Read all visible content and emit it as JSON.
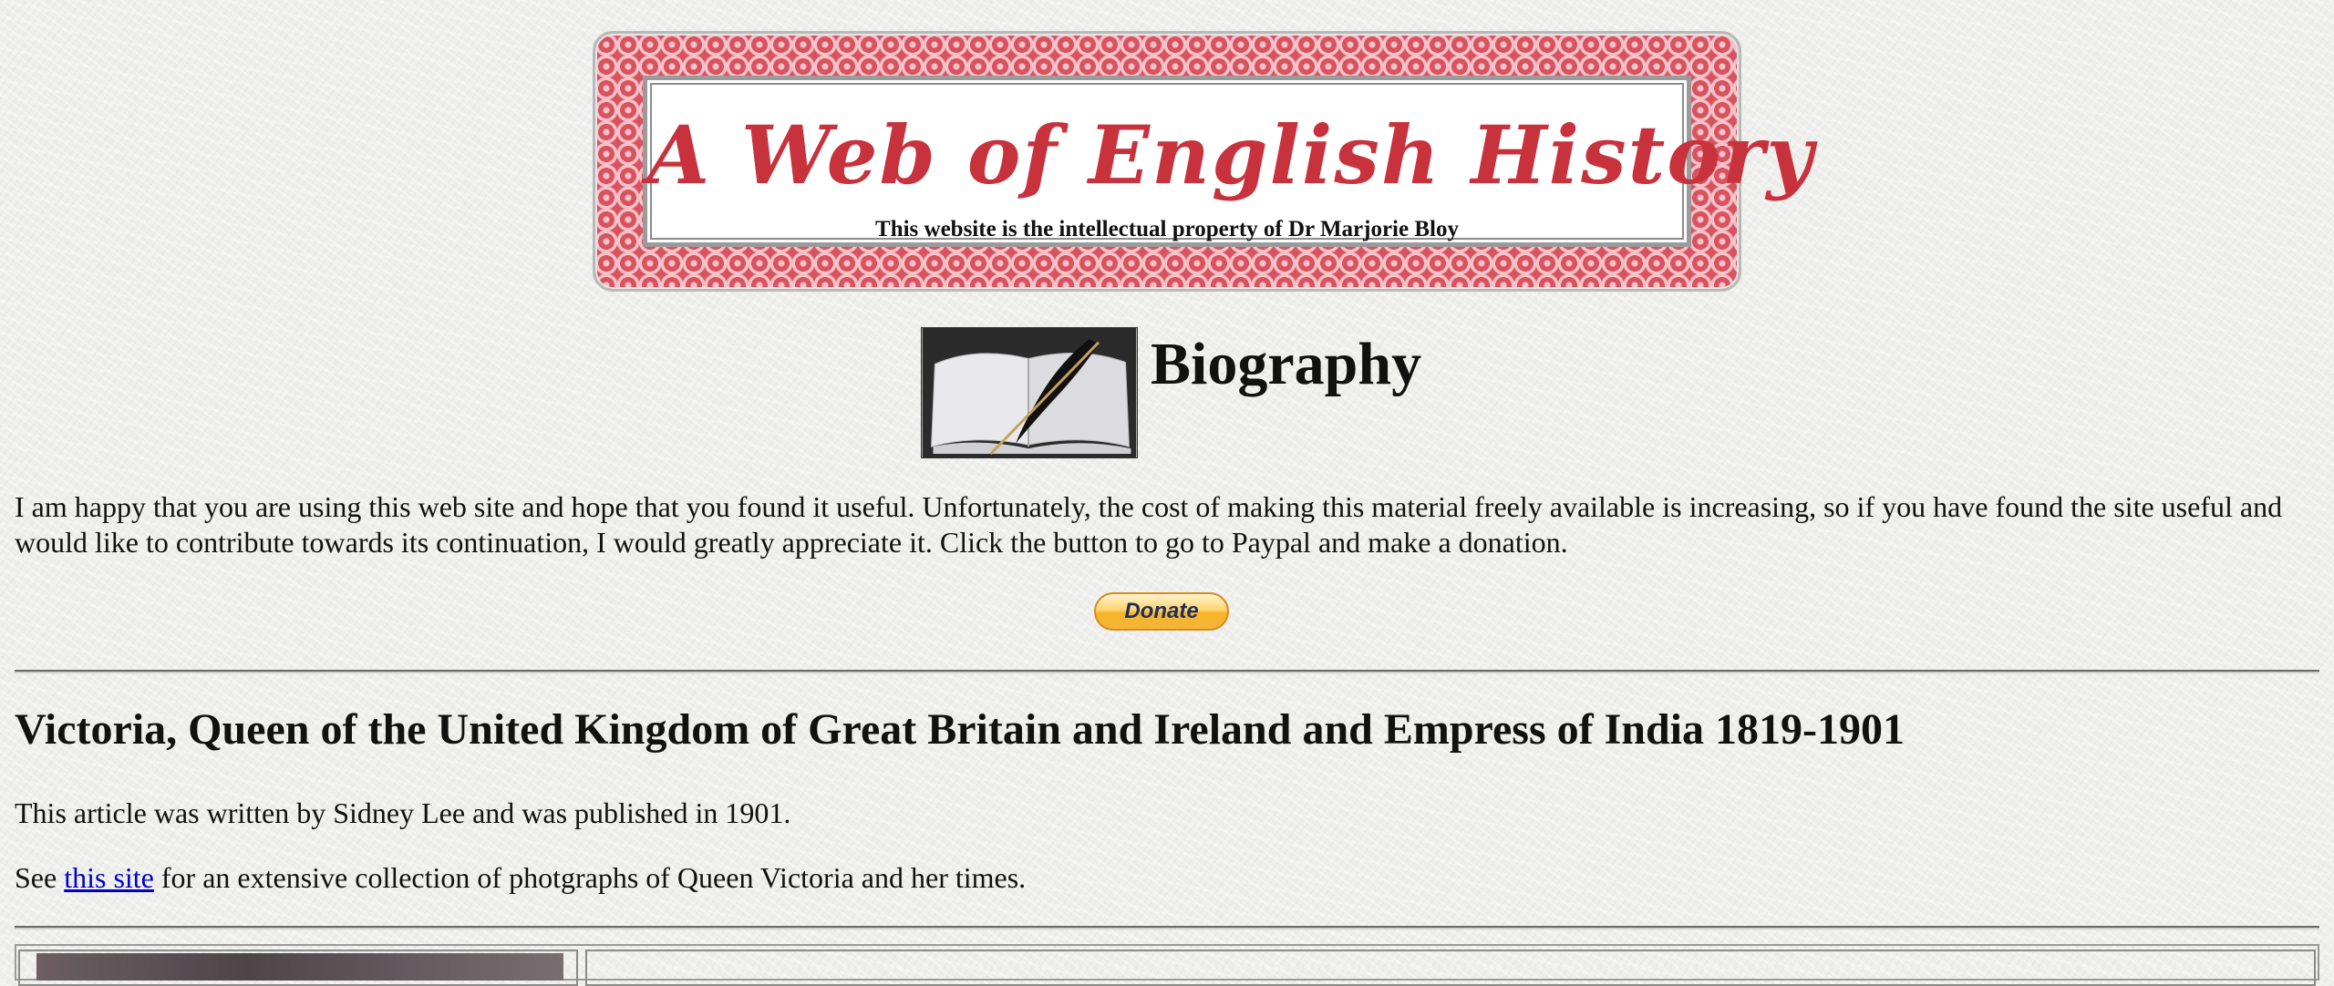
{
  "banner": {
    "title": "A Web of English History",
    "subtitle": "This website is the intellectual property of Dr Marjorie Bloy",
    "colors": {
      "frame": "#d9525f",
      "title": "#c8323c"
    }
  },
  "biography": {
    "heading": "Biography",
    "image_icon": "book-quill-icon"
  },
  "intro": {
    "text": "I am happy that you are using this web site and hope that you found it useful. Unfortunately, the cost of making this material freely available is increasing, so if you have found the site useful and would like to contribute towards its continuation, I would greatly appreciate it. Click the button to go to Paypal and make a donation."
  },
  "donate": {
    "label": "Donate"
  },
  "article": {
    "title": "Victoria, Queen of the United Kingdom of Great Britain and Ireland and Empress of India 1819-1901",
    "byline": "This article was written by Sidney Lee and was published in 1901.",
    "see_prefix": "See ",
    "link_text": "this site",
    "see_suffix": " for an extensive collection of photgraphs of Queen Victoria and her times."
  }
}
